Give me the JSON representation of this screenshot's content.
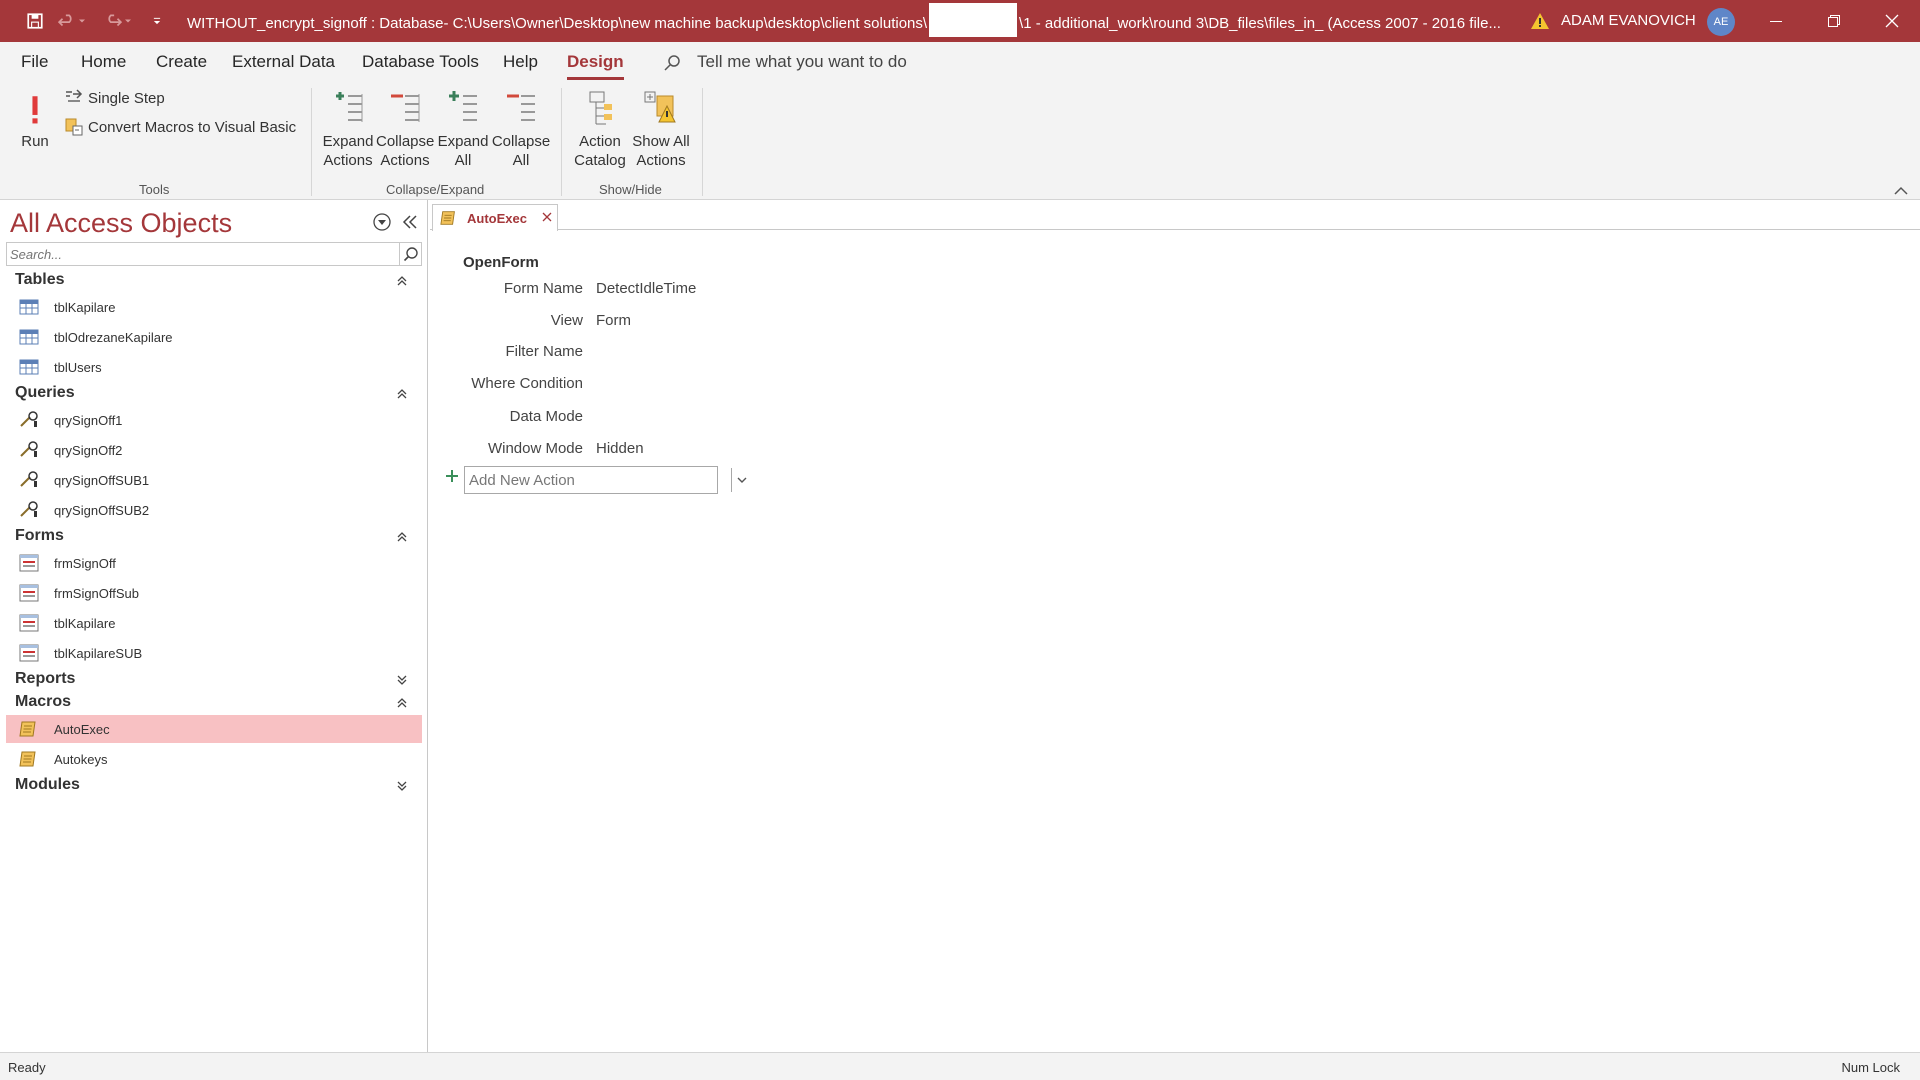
{
  "title_bar": {
    "title_left": "WITHOUT_encrypt_signoff : Database- C:\\Users\\Owner\\Desktop\\new machine backup\\desktop\\client solutions\\",
    "title_right": "\\1 - additional_work\\round 3\\DB_files\\files_in_ (Access 2007 - 2016 file...",
    "user_name": "ADAM EVANOVICH",
    "user_initials": "AE"
  },
  "tabs": [
    "File",
    "Home",
    "Create",
    "External Data",
    "Database Tools",
    "Help",
    "Design"
  ],
  "active_tab": "Design",
  "tell_me": "Tell me what you want to do",
  "ribbon": {
    "tools": {
      "label": "Tools",
      "run": "Run",
      "single_step": "Single Step",
      "convert": "Convert Macros to Visual Basic"
    },
    "collapse_expand": {
      "label": "Collapse/Expand",
      "expand_actions": [
        "Expand",
        "Actions"
      ],
      "collapse_actions": [
        "Collapse",
        "Actions"
      ],
      "expand_all": [
        "Expand",
        "All"
      ],
      "collapse_all": [
        "Collapse",
        "All"
      ]
    },
    "show_hide": {
      "label": "Show/Hide",
      "action_catalog": [
        "Action",
        "Catalog"
      ],
      "show_all_actions": [
        "Show All",
        "Actions"
      ]
    }
  },
  "nav_pane": {
    "title": "All Access Objects",
    "search_placeholder": "Search...",
    "groups": {
      "tables": {
        "label": "Tables",
        "items": [
          "tblKapilare",
          "tblOdrezaneKapilare",
          "tblUsers"
        ]
      },
      "queries": {
        "label": "Queries",
        "items": [
          "qrySignOff1",
          "qrySignOff2",
          "qrySignOffSUB1",
          "qrySignOffSUB2"
        ]
      },
      "forms": {
        "label": "Forms",
        "items": [
          "frmSignOff",
          "frmSignOffSub",
          "tblKapilare",
          "tblKapilareSUB"
        ]
      },
      "reports": {
        "label": "Reports"
      },
      "macros": {
        "label": "Macros",
        "items": [
          "AutoExec",
          "Autokeys"
        ]
      },
      "modules": {
        "label": "Modules"
      }
    },
    "selected_item": "AutoExec"
  },
  "document": {
    "tab_label": "AutoExec",
    "action": "OpenForm",
    "arguments": [
      {
        "label": "Form Name",
        "value": "DetectIdleTime"
      },
      {
        "label": "View",
        "value": "Form"
      },
      {
        "label": "Filter Name",
        "value": ""
      },
      {
        "label": "Where Condition",
        "value": ""
      },
      {
        "label": "Data Mode",
        "value": ""
      },
      {
        "label": "Window Mode",
        "value": "Hidden"
      }
    ],
    "add_new_action": "Add New Action"
  },
  "status_bar": {
    "left": "Ready",
    "right": "Num Lock"
  },
  "colors": {
    "accent": "#a4373a",
    "selected": "#f8c1c3",
    "avatar": "#5f86c8"
  }
}
